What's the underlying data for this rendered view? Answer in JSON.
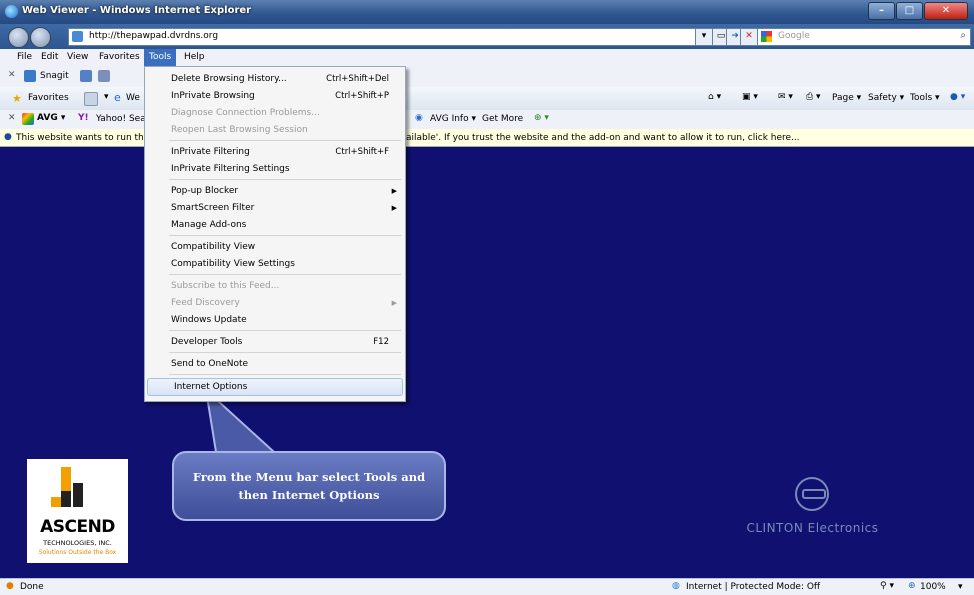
{
  "window": {
    "title": "Web Viewer - Windows Internet Explorer"
  },
  "address": {
    "url": "http://thepawpad.dvrdns.org",
    "search_placeholder": "Google"
  },
  "menubar": {
    "items": [
      "File",
      "Edit",
      "View",
      "Favorites",
      "Tools",
      "Help"
    ]
  },
  "snagit": {
    "label": "Snagit"
  },
  "favbar": {
    "favorites_label": "Favorites",
    "tab_label": "We",
    "right": {
      "page": "Page ▾",
      "safety": "Safety ▾",
      "tools": "Tools ▾"
    }
  },
  "avgbar": {
    "avg_label": "AVG ▾",
    "yahoo_label": "Yahoo! Sea",
    "avg_info": "AVG Info ▾",
    "get_more": "Get More"
  },
  "infobar": {
    "text_left": "This website wants to run the",
    "text_right": "ailable'. If you trust the website and the add-on and want to allow it to run, click here..."
  },
  "tools_menu": {
    "groups": [
      [
        {
          "label": "Delete Browsing History...",
          "shortcut": "Ctrl+Shift+Del",
          "disabled": false
        },
        {
          "label": "InPrivate Browsing",
          "shortcut": "Ctrl+Shift+P",
          "disabled": false
        },
        {
          "label": "Diagnose Connection Problems...",
          "shortcut": "",
          "disabled": true
        },
        {
          "label": "Reopen Last Browsing Session",
          "shortcut": "",
          "disabled": true
        }
      ],
      [
        {
          "label": "InPrivate Filtering",
          "shortcut": "Ctrl+Shift+F",
          "disabled": false
        },
        {
          "label": "InPrivate Filtering Settings",
          "shortcut": "",
          "disabled": false
        }
      ],
      [
        {
          "label": "Pop-up Blocker",
          "shortcut": "",
          "submenu": true,
          "disabled": false
        },
        {
          "label": "SmartScreen Filter",
          "shortcut": "",
          "submenu": true,
          "disabled": false
        },
        {
          "label": "Manage Add-ons",
          "shortcut": "",
          "disabled": false
        }
      ],
      [
        {
          "label": "Compatibility View",
          "shortcut": "",
          "disabled": false
        },
        {
          "label": "Compatibility View Settings",
          "shortcut": "",
          "disabled": false
        }
      ],
      [
        {
          "label": "Subscribe to this Feed...",
          "shortcut": "",
          "disabled": true
        },
        {
          "label": "Feed Discovery",
          "shortcut": "",
          "submenu": true,
          "disabled": true
        },
        {
          "label": "Windows Update",
          "shortcut": "",
          "disabled": false
        }
      ],
      [
        {
          "label": "Developer Tools",
          "shortcut": "F12",
          "disabled": false
        }
      ],
      [
        {
          "label": "Send to OneNote",
          "shortcut": "",
          "disabled": false
        }
      ],
      [
        {
          "label": "Internet Options",
          "shortcut": "",
          "disabled": false,
          "highlighted": true
        }
      ]
    ]
  },
  "callout": {
    "line1": "From the Menu bar select Tools and",
    "line2": "then Internet Options"
  },
  "ascend_logo": {
    "name": "ASCEND",
    "sub": "TECHNOLOGIES, INC.",
    "tagline": "Solutions Outside the Box"
  },
  "clinton_logo": {
    "text": "CLINTON Electronics"
  },
  "statusbar": {
    "left": "Done",
    "zone": "Internet | Protected Mode: Off",
    "zoom": "100%"
  },
  "colors": {
    "page_background": "#101070",
    "menu_highlight": "#3a6fc0"
  }
}
